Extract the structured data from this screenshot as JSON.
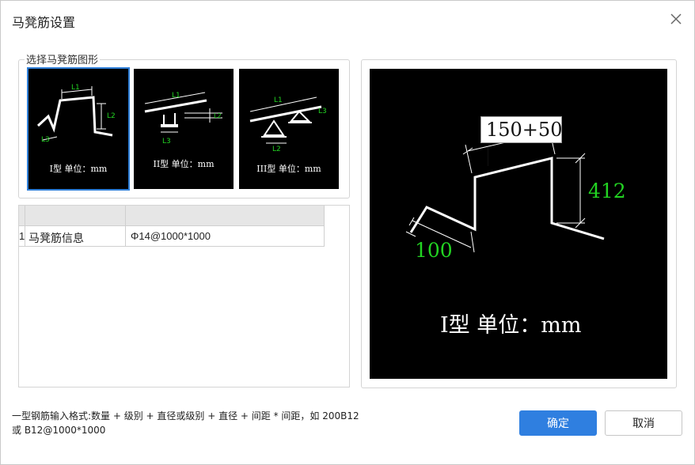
{
  "dialog": {
    "title": "马凳筋设置",
    "close_icon": "close-icon"
  },
  "shape_group": {
    "label": "选择马凳筋图形",
    "options": [
      {
        "caption": "I型 单位：mm",
        "selected": true,
        "dims": [
          "L1",
          "L2",
          "L3"
        ]
      },
      {
        "caption": "II型 单位：mm",
        "selected": false,
        "dims": [
          "L1",
          "L2",
          "L3"
        ]
      },
      {
        "caption": "III型 单位：mm",
        "selected": false,
        "dims": [
          "L1",
          "L2",
          "L3"
        ]
      }
    ]
  },
  "table": {
    "rows": [
      {
        "index": "1",
        "name": "马凳筋信息",
        "value": "Φ14@1000*1000"
      }
    ]
  },
  "preview": {
    "l1_input": "150+50",
    "l2_value": "412",
    "l3_value": "100",
    "caption": "I型 单位：mm",
    "accent_green": "#22d322"
  },
  "hint": {
    "line1": "一型钢筋输入格式:数量 + 级别 + 直径或级别 + 直径 + 间距 * 间距，如 200B12",
    "line2": "或 B12@1000*1000"
  },
  "buttons": {
    "ok": "确定",
    "cancel": "取消",
    "accent": "#2f7fe0"
  }
}
